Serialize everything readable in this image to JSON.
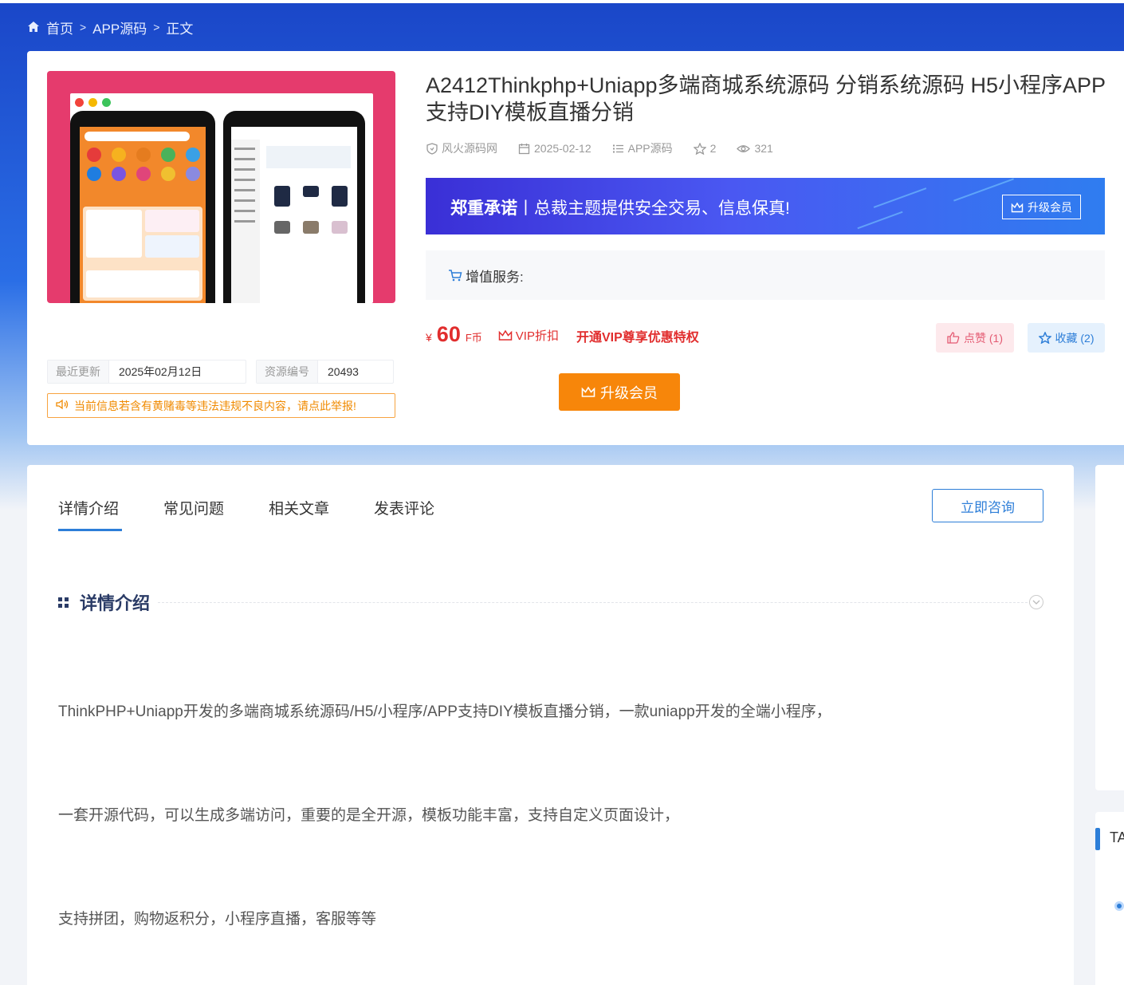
{
  "breadcrumb": {
    "home": "首页",
    "category": "APP源码",
    "current": "正文"
  },
  "product": {
    "title": " A2412Thinkphp+Uniapp多端商城系统源码 分销系统源码 H5小程序APP支持DIY模板直播分销",
    "author": "风火源码网",
    "date": "2025-02-12",
    "category": "APP源码",
    "stars": "2",
    "views": "321",
    "updated_label": "最近更新",
    "updated_value": "2025年02月12日",
    "id_label": "资源编号",
    "id_value": "20493",
    "report_text": "当前信息若含有黄赌毒等违法违规不良内容，请点此举报!"
  },
  "promise": {
    "bold": "郑重承诺",
    "sep": "丨",
    "text": "总裁主题提供安全交易、信息保真!",
    "button": "升级会员"
  },
  "service": {
    "label": "增值服务:"
  },
  "price": {
    "yen": "¥",
    "value": "60",
    "unit": "F币",
    "vip_discount": "VIP折扣",
    "vip_open": "开通VIP尊享优惠特权"
  },
  "actions": {
    "like": "点赞 (1)",
    "favorite": "收藏 (2)",
    "upgrade": "升级会员"
  },
  "tabs": [
    "详情介绍",
    "常见问题",
    "相关文章",
    "发表评论"
  ],
  "consult_button": "立即咨询",
  "section_title": "详情介绍",
  "paragraphs": [
    "ThinkPHP+Uniapp开发的多端商城系统源码/H5/小程序/APP支持DIY模板直播分销，一款uniapp开发的全端小程序，",
    "一套开源代码，可以生成多端访问，重要的是全开源，模板功能丰富，支持自定义页面设计，",
    "支持拼团，购物返积分，小程序直播，客服等等"
  ],
  "sidebar": {
    "tag_title": "TA"
  },
  "colors": {
    "accent": "#2d7ed8",
    "price": "#e12d2d",
    "vip_button": "#f7860a",
    "thumb_bg": "#e53b6d"
  }
}
